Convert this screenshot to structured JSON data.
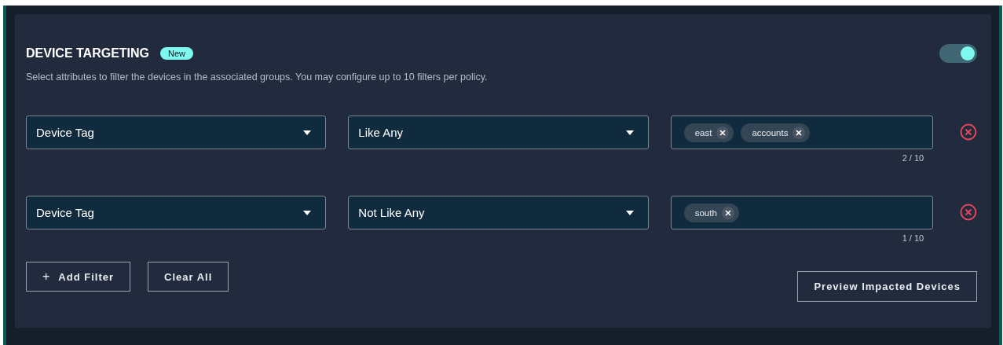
{
  "section": {
    "title": "DEVICE TARGETING",
    "badge": "New",
    "enabled": true,
    "description": "Select attributes to filter the devices in the associated groups. You may configure up to 10 filters per policy."
  },
  "filters": [
    {
      "attribute": "Device Tag",
      "operator": "Like Any",
      "tags": [
        "east",
        "accounts"
      ],
      "count": "2 / 10"
    },
    {
      "attribute": "Device Tag",
      "operator": "Not Like Any",
      "tags": [
        "south"
      ],
      "count": "1 / 10"
    }
  ],
  "actions": {
    "add": "Add Filter",
    "add_icon": "+",
    "clear": "Clear All",
    "preview": "Preview Impacted Devices"
  }
}
